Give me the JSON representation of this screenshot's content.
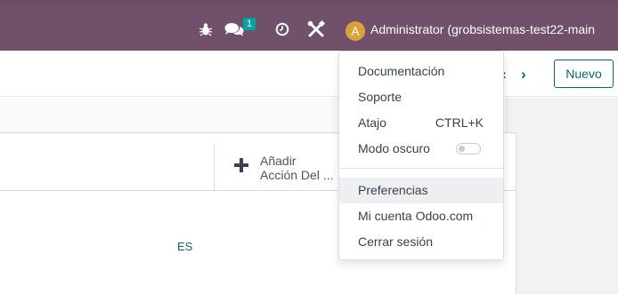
{
  "navbar": {
    "message_count": "1",
    "avatar_initial": "A",
    "user_label": "Administrator (grobsistemas-test22-main",
    "icons": [
      "bug-icon",
      "chat-icon",
      "clock-icon",
      "tools-icon"
    ]
  },
  "control_panel": {
    "pager_prev": "‹",
    "pager_next": "›",
    "new_button": "Nuevo"
  },
  "form": {
    "smart_button": {
      "line1": "Añadir",
      "line2": "Acción Del ..."
    },
    "language": "ES"
  },
  "user_menu": {
    "items": [
      {
        "label": "Documentación"
      },
      {
        "label": "Soporte"
      },
      {
        "label": "Atajo",
        "shortcut": "CTRL+K"
      },
      {
        "label": "Modo oscuro",
        "toggle_on": false
      },
      {
        "label": "Preferencias",
        "highlighted": true
      },
      {
        "label": "Mi cuenta Odoo.com"
      },
      {
        "label": "Cerrar sesión"
      }
    ]
  },
  "colors": {
    "navbar": "#70506a",
    "accent": "#0e6673",
    "badge": "#01a6a1",
    "avatar": "#dba23c"
  }
}
